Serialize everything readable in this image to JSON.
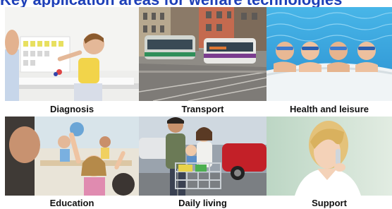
{
  "header_fragment": "Key application areas for welfare technologies",
  "tiles": [
    {
      "label": "Diagnosis",
      "image_icon": "child-therapy-photo"
    },
    {
      "label": "Transport",
      "image_icon": "tram-photo"
    },
    {
      "label": "Health and leisure",
      "image_icon": "swimming-children-photo"
    },
    {
      "label": "Education",
      "image_icon": "classroom-photo"
    },
    {
      "label": "Daily living",
      "image_icon": "family-shopping-photo"
    },
    {
      "label": "Support",
      "image_icon": "phone-support-photo"
    }
  ],
  "colors": {
    "header": "#1d3fb8",
    "caption": "#111111",
    "background": "#ffffff"
  }
}
